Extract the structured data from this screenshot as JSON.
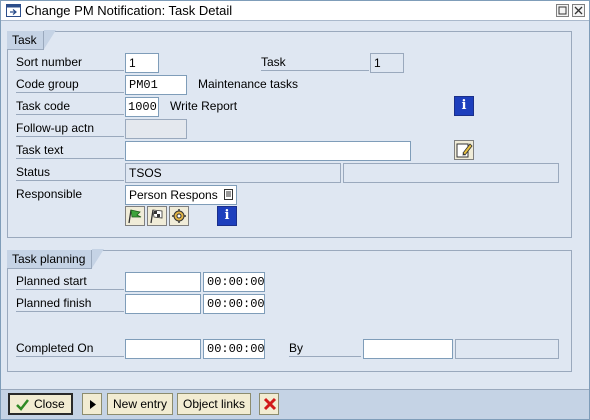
{
  "window": {
    "title": "Change PM Notification: Task Detail"
  },
  "task_group": {
    "title": "Task",
    "sort_number": {
      "label": "Sort number",
      "value": "1"
    },
    "task": {
      "label": "Task",
      "value": "1"
    },
    "code_group": {
      "label": "Code group",
      "value": "PM01",
      "description": "Maintenance tasks"
    },
    "task_code": {
      "label": "Task code",
      "value": "1000",
      "description": "Write Report"
    },
    "follow_up": {
      "label": "Follow-up actn",
      "value": ""
    },
    "task_text": {
      "label": "Task text",
      "value": ""
    },
    "status": {
      "label": "Status",
      "value": "TSOS",
      "value2": ""
    },
    "responsible": {
      "label": "Responsible",
      "value": "Person Respons"
    }
  },
  "planning_group": {
    "title": "Task planning",
    "planned_start": {
      "label": "Planned start",
      "date": "",
      "time": "00:00:00"
    },
    "planned_finish": {
      "label": "Planned finish",
      "date": "",
      "time": "00:00:00"
    },
    "completed_on": {
      "label": "Completed On",
      "date": "",
      "time": "00:00:00"
    },
    "by": {
      "label": "By",
      "value": "",
      "value2": ""
    }
  },
  "footer": {
    "close_label": "Close",
    "new_entry_label": "New entry",
    "object_links_label": "Object links"
  },
  "icons": {
    "info": "i"
  }
}
